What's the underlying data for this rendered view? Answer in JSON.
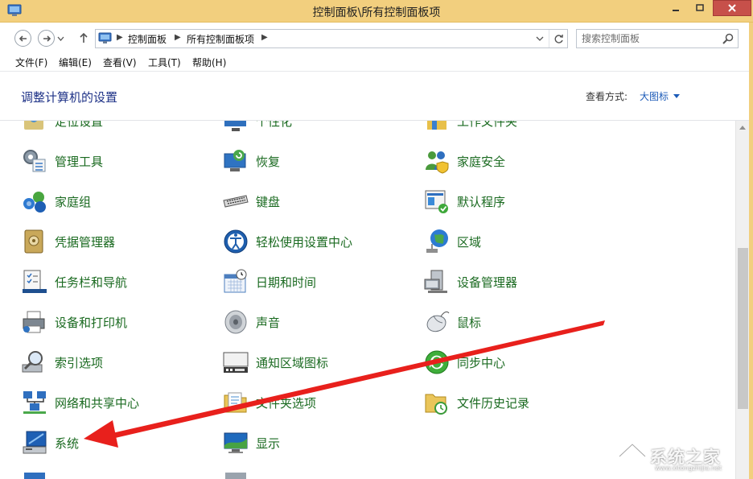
{
  "window": {
    "title": "控制面板\\所有控制面板项"
  },
  "address": {
    "crumbs": [
      "控制面板",
      "所有控制面板项"
    ]
  },
  "search": {
    "placeholder": "搜索控制面板"
  },
  "menu": {
    "items": [
      "文件(F)",
      "编辑(E)",
      "查看(V)",
      "工具(T)",
      "帮助(H)"
    ]
  },
  "header": {
    "title": "调整计算机的设置",
    "view_label": "查看方式:",
    "view_value": "大图标"
  },
  "items": {
    "r0c0": "定位设置",
    "r0c1": "个性化",
    "r0c2": "工作文件夹",
    "r1c0": "管理工具",
    "r1c1": "恢复",
    "r1c2": "家庭安全",
    "r2c0": "家庭组",
    "r2c1": "键盘",
    "r2c2": "默认程序",
    "r3c0": "凭据管理器",
    "r3c1": "轻松使用设置中心",
    "r3c2": "区域",
    "r4c0": "任务栏和导航",
    "r4c1": "日期和时间",
    "r4c2": "设备管理器",
    "r5c0": "设备和打印机",
    "r5c1": "声音",
    "r5c2": "鼠标",
    "r6c0": "索引选项",
    "r6c1": "通知区域图标",
    "r6c2": "同步中心",
    "r7c0": "网络和共享中心",
    "r7c1": "文件夹选项",
    "r7c2": "文件历史记录",
    "r8c0": "系统",
    "r8c1": "显示"
  },
  "watermark": {
    "text": "系统之家",
    "url": "www.xitongzhijia.net"
  },
  "colors": {
    "titlebar": "#f2cf7e",
    "link_green": "#1a6a20",
    "header_blue": "#1e3287",
    "annotation_red": "#e8201c"
  }
}
